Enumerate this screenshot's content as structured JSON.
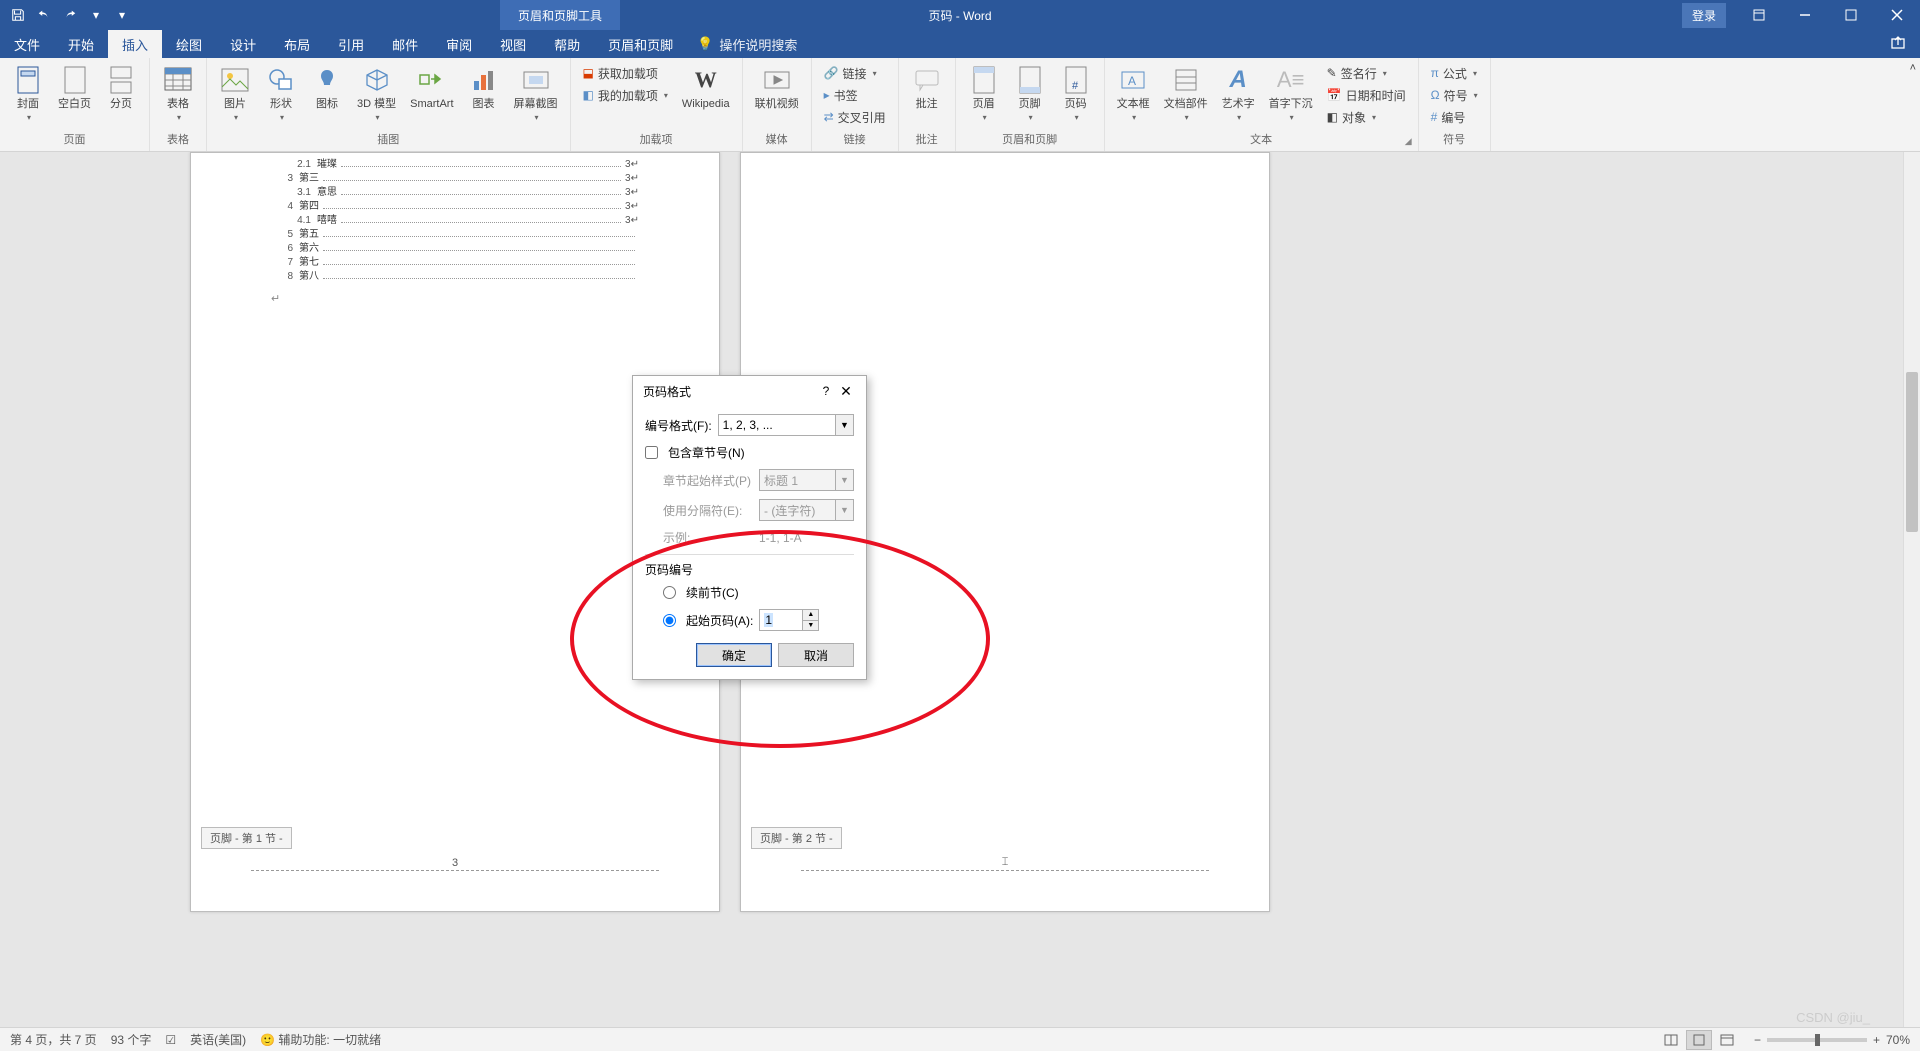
{
  "titlebar": {
    "doc_title": "页码 - Word",
    "context_tool": "页眉和页脚工具",
    "login": "登录"
  },
  "tabs": {
    "file": "文件",
    "home": "开始",
    "insert": "插入",
    "draw": "绘图",
    "design": "设计",
    "layout": "布局",
    "references": "引用",
    "mailings": "邮件",
    "review": "审阅",
    "view": "视图",
    "help": "帮助",
    "hf": "页眉和页脚",
    "tellme": "操作说明搜索"
  },
  "ribbon": {
    "pages": {
      "cover": "封面",
      "blank": "空白页",
      "break": "分页",
      "group": "页面"
    },
    "tables": {
      "table": "表格",
      "group": "表格"
    },
    "illus": {
      "pictures": "图片",
      "shapes": "形状",
      "icons": "图标",
      "models": "3D 模型",
      "smartart": "SmartArt",
      "chart": "图表",
      "screenshot": "屏幕截图",
      "group": "插图"
    },
    "addins": {
      "get": "获取加载项",
      "my": "我的加载项",
      "wiki": "Wikipedia",
      "group": "加载项"
    },
    "media": {
      "video": "联机视频",
      "group": "媒体"
    },
    "links": {
      "link": "链接",
      "bookmark": "书签",
      "xref": "交叉引用",
      "group": "链接"
    },
    "comments": {
      "comment": "批注",
      "group": "批注"
    },
    "hf": {
      "header": "页眉",
      "footer": "页脚",
      "pagenum": "页码",
      "group": "页眉和页脚"
    },
    "text": {
      "textbox": "文本框",
      "quickparts": "文档部件",
      "wordart": "艺术字",
      "dropcap": "首字下沉",
      "sig": "签名行",
      "date": "日期和时间",
      "object": "对象",
      "group": "文本"
    },
    "symbols": {
      "equation": "公式",
      "symbol": "符号",
      "number": "编号",
      "group": "符号"
    }
  },
  "toc": [
    {
      "level": 2,
      "num": "2.1",
      "txt": "璀璨",
      "pg": "3"
    },
    {
      "level": 1,
      "num": "3",
      "txt": "第三",
      "pg": "3"
    },
    {
      "level": 2,
      "num": "3.1",
      "txt": "意思",
      "pg": "3"
    },
    {
      "level": 1,
      "num": "4",
      "txt": "第四",
      "pg": "3"
    },
    {
      "level": 2,
      "num": "4.1",
      "txt": "嘻嘻",
      "pg": "3"
    },
    {
      "level": 1,
      "num": "5",
      "txt": "第五",
      "pg": ""
    },
    {
      "level": 1,
      "num": "6",
      "txt": "第六",
      "pg": ""
    },
    {
      "level": 1,
      "num": "7",
      "txt": "第七",
      "pg": ""
    },
    {
      "level": 1,
      "num": "8",
      "txt": "第八",
      "pg": ""
    }
  ],
  "footer_tags": {
    "p1": "页脚 - 第 1 节 -",
    "p1_num": "3",
    "p2": "页脚 - 第 2 节 -"
  },
  "dialog": {
    "title": "页码格式",
    "format_label": "编号格式(F):",
    "format_value": "1, 2, 3, ...",
    "include_chapter": "包含章节号(N)",
    "chapter_style_label": "章节起始样式(P)",
    "chapter_style_value": "标题 1",
    "separator_label": "使用分隔符(E):",
    "separator_value": "- (连字符)",
    "example_label": "示例:",
    "example_value": "1-1, 1-A",
    "section_label": "页码编号",
    "continue": "续前节(C)",
    "start_at": "起始页码(A):",
    "start_value": "1",
    "ok": "确定",
    "cancel": "取消"
  },
  "status": {
    "page": "第 4 页，共 7 页",
    "words": "93 个字",
    "lang": "英语(美国)",
    "a11y": "辅助功能: 一切就绪",
    "zoom": "70%"
  },
  "watermark": "CSDN @jiu_"
}
